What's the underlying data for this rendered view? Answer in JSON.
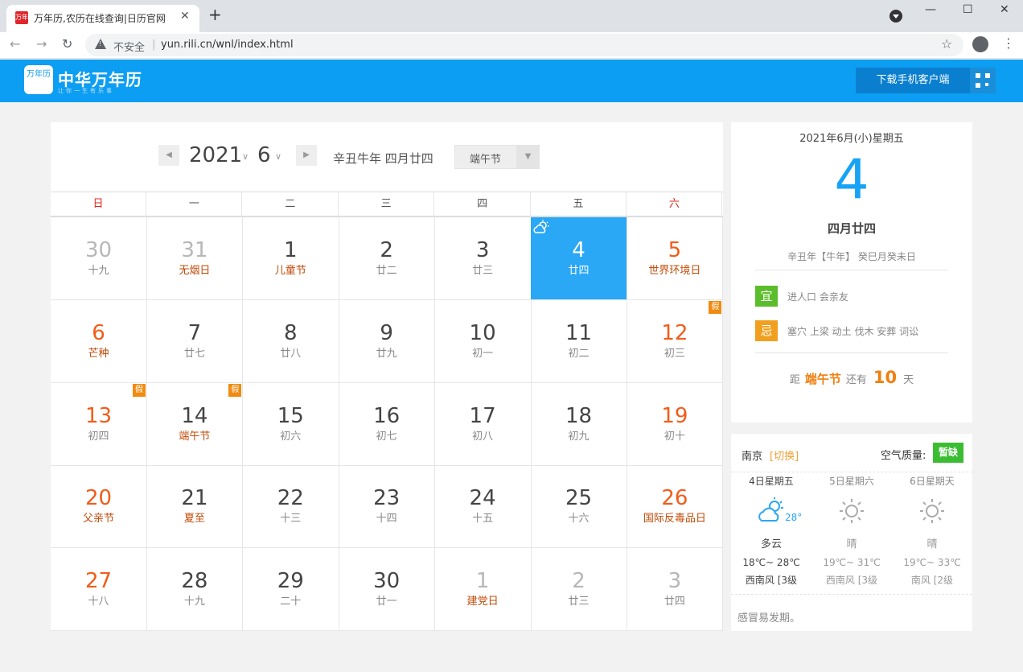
{
  "browser": {
    "tab_title": "万年历,农历在线查询|日历官网",
    "tab_favicon_text": "万年",
    "security_label": "不安全",
    "url": "yun.rili.cn/wnl/index.html"
  },
  "header": {
    "logo_mark": "万年历",
    "logo_text": "中华万年历",
    "logo_slogan": "让你一生有乐事",
    "download_label": "下载手机客户端"
  },
  "calendar": {
    "prev_label": "◀",
    "next_label": "▶",
    "year": "2021",
    "month": "6",
    "lunar_header": "辛丑牛年 四月廿四",
    "festival_select": "端午节",
    "weekdays": [
      "日",
      "一",
      "二",
      "三",
      "四",
      "五",
      "六"
    ],
    "holiday_mark": "假",
    "days": [
      {
        "n": "30",
        "s": "十九",
        "t": "other"
      },
      {
        "n": "31",
        "s": "无烟日",
        "t": "other fest"
      },
      {
        "n": "1",
        "s": "儿童节",
        "t": "fest"
      },
      {
        "n": "2",
        "s": "廿二",
        "t": ""
      },
      {
        "n": "3",
        "s": "廿三",
        "t": ""
      },
      {
        "n": "4",
        "s": "廿四",
        "t": "today"
      },
      {
        "n": "5",
        "s": "世界环境日",
        "t": "weekend fest"
      },
      {
        "n": "6",
        "s": "芒种",
        "t": "weekend fest"
      },
      {
        "n": "7",
        "s": "廿七",
        "t": ""
      },
      {
        "n": "8",
        "s": "廿八",
        "t": ""
      },
      {
        "n": "9",
        "s": "廿九",
        "t": ""
      },
      {
        "n": "10",
        "s": "初一",
        "t": ""
      },
      {
        "n": "11",
        "s": "初二",
        "t": ""
      },
      {
        "n": "12",
        "s": "初三",
        "t": "weekend",
        "h": true
      },
      {
        "n": "13",
        "s": "初四",
        "t": "weekend",
        "h": true
      },
      {
        "n": "14",
        "s": "端午节",
        "t": "fest",
        "h": true
      },
      {
        "n": "15",
        "s": "初六",
        "t": ""
      },
      {
        "n": "16",
        "s": "初七",
        "t": ""
      },
      {
        "n": "17",
        "s": "初八",
        "t": ""
      },
      {
        "n": "18",
        "s": "初九",
        "t": ""
      },
      {
        "n": "19",
        "s": "初十",
        "t": "weekend"
      },
      {
        "n": "20",
        "s": "父亲节",
        "t": "weekend fest"
      },
      {
        "n": "21",
        "s": "夏至",
        "t": "fest"
      },
      {
        "n": "22",
        "s": "十三",
        "t": ""
      },
      {
        "n": "23",
        "s": "十四",
        "t": ""
      },
      {
        "n": "24",
        "s": "十五",
        "t": ""
      },
      {
        "n": "25",
        "s": "十六",
        "t": ""
      },
      {
        "n": "26",
        "s": "国际反毒品日",
        "t": "weekend fest"
      },
      {
        "n": "27",
        "s": "十八",
        "t": "weekend"
      },
      {
        "n": "28",
        "s": "十九",
        "t": ""
      },
      {
        "n": "29",
        "s": "二十",
        "t": ""
      },
      {
        "n": "30",
        "s": "廿一",
        "t": ""
      },
      {
        "n": "1",
        "s": "建党日",
        "t": "other fest"
      },
      {
        "n": "2",
        "s": "廿三",
        "t": "other"
      },
      {
        "n": "3",
        "s": "廿四",
        "t": "other"
      }
    ]
  },
  "info": {
    "date_line": "2021年6月(小)星期五",
    "day": "4",
    "lunar": "四月廿四",
    "ganzhi": "辛丑年【牛年】 癸巳月癸未日",
    "yi_label": "宜",
    "yi_text": "进人口 会亲友",
    "ji_label": "忌",
    "ji_text": "塞穴 上梁 动土 伐木 安葬 词讼",
    "countdown_prefix": "距",
    "countdown_festival": "端午节",
    "countdown_mid": "还有",
    "countdown_days": "10",
    "countdown_suffix": "天"
  },
  "weather": {
    "city": "南京",
    "switch_label": "[切换]",
    "aq_label": "空气质量:",
    "aq_value": "暂缺",
    "current_temp": "28°",
    "days": [
      {
        "day": "4日星期五",
        "cond": "多云",
        "temp": "18℃~ 28℃",
        "wind": "西南风 [3级",
        "icon": "partly-cloudy-icon"
      },
      {
        "day": "5日星期六",
        "cond": "晴",
        "temp": "19℃~ 31℃",
        "wind": "西南风 [3级",
        "icon": "sunny-icon"
      },
      {
        "day": "6日星期天",
        "cond": "晴",
        "temp": "19℃~ 33℃",
        "wind": "南风 [2级",
        "icon": "sunny-icon"
      }
    ],
    "tip": "感冒易发期。"
  },
  "colors": {
    "brand": "#0c9ef2",
    "today": "#2aa7f5",
    "weekend": "#f25c19",
    "festival": "#c24a07",
    "holiday": "#f08b12",
    "yi": "#5bbd2b",
    "ji": "#f0a01e"
  }
}
